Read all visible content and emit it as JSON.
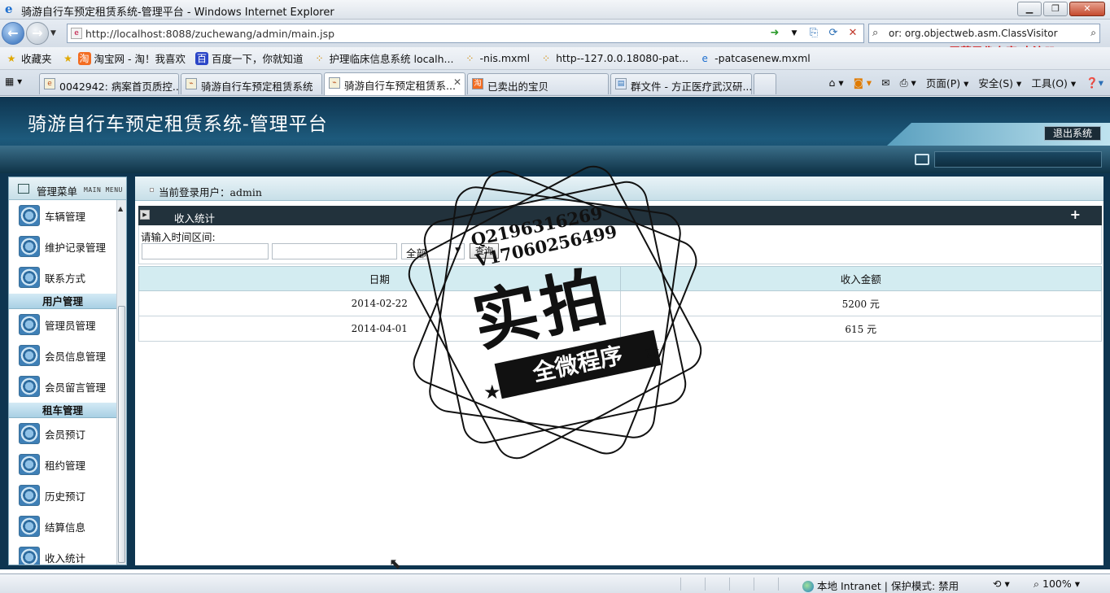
{
  "browser": {
    "window_title": "骑游自行车预定租赁系统-管理平台 - Windows Internet Explorer",
    "url": "http://localhost:8088/zuchewang/admin/main.jsp",
    "search_text": "or: org.objectweb.asm.ClassVisitor",
    "recorder_watermark": "屏幕录像专家 未注册",
    "favorites_label": "收藏夹",
    "favorites": [
      "淘宝网 - 淘！我喜欢",
      "百度一下，你就知道",
      "护理临床信息系统 localh...",
      "-nis.mxml",
      "http--127.0.0.18080-pat...",
      "-patcasenew.mxml"
    ],
    "tabs": [
      {
        "label": "0042942: 病案首页质控..."
      },
      {
        "label": "骑游自行车预定租赁系统"
      },
      {
        "label": "骑游自行车预定租赁系..."
      },
      {
        "label": "已卖出的宝贝"
      },
      {
        "label": "群文件 - 方正医疗武汉研..."
      }
    ],
    "commands": {
      "page": "页面(P)",
      "safety": "安全(S)",
      "tools": "工具(O)"
    },
    "status": {
      "zone": "本地 Intranet | 保护模式: 禁用",
      "zoom": "100%"
    }
  },
  "app": {
    "title": "骑游自行车预定租赁系统-管理平台",
    "logout": "退出系统",
    "sidebar": {
      "title": "管理菜单",
      "subtitle": "MAIN MENU",
      "items": [
        {
          "type": "item",
          "label": "车辆管理"
        },
        {
          "type": "item",
          "label": "维护记录管理"
        },
        {
          "type": "item",
          "label": "联系方式"
        },
        {
          "type": "group",
          "label": "用户管理"
        },
        {
          "type": "item",
          "label": "管理员管理"
        },
        {
          "type": "item",
          "label": "会员信息管理"
        },
        {
          "type": "item",
          "label": "会员留言管理"
        },
        {
          "type": "group",
          "label": "租车管理"
        },
        {
          "type": "item",
          "label": "会员预订"
        },
        {
          "type": "item",
          "label": "租约管理"
        },
        {
          "type": "item",
          "label": "历史预订"
        },
        {
          "type": "item",
          "label": "结算信息"
        },
        {
          "type": "item",
          "label": "收入统计"
        }
      ]
    },
    "user": {
      "label": "当前登录用户：",
      "name": "admin"
    },
    "panel": {
      "title": "收入统计",
      "query_label": "请输入时间区间:",
      "select_value": "全部",
      "query_button": "查询",
      "columns": [
        "日期",
        "收入金额"
      ],
      "rows": [
        {
          "date": "2014-02-22",
          "amount": "5200 元"
        },
        {
          "date": "2014-04-01",
          "amount": "615 元"
        }
      ]
    }
  },
  "stamp": {
    "contact_q": "Q2196316269",
    "contact_v": "V17060256499",
    "main_text": "实拍",
    "ribbon_text": "全微程序"
  }
}
